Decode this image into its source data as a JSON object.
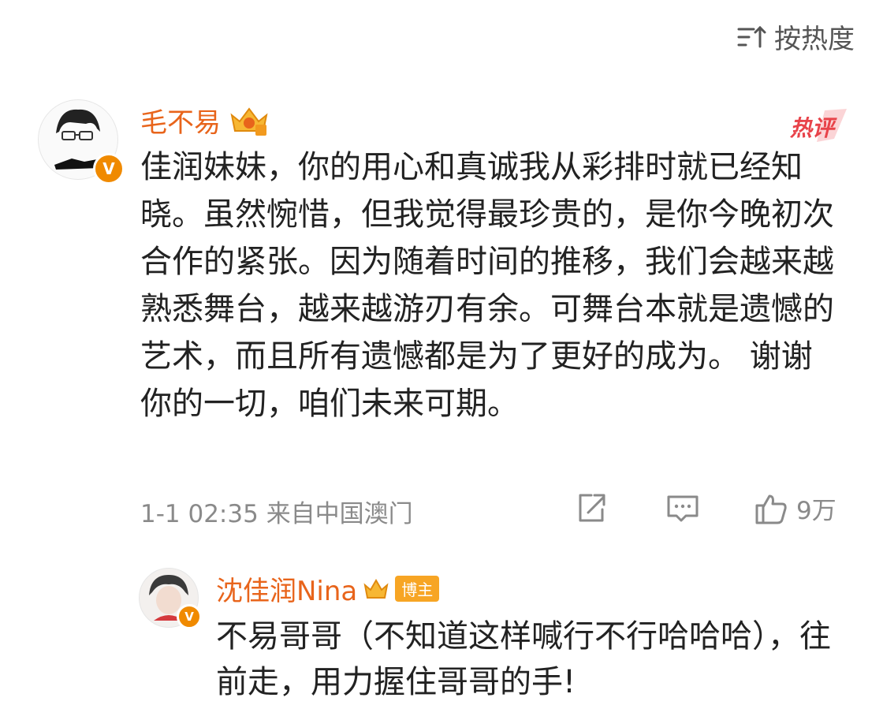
{
  "sort": {
    "label": "按热度",
    "icon": "sort-icon"
  },
  "comment": {
    "username": "毛不易",
    "badge_icon": "crown-badge-icon",
    "hot_label": "热评",
    "text": "佳润妹妹，你的用心和真诚我从彩排时就已经知晓。虽然惋惜，但我觉得最珍贵的，是你今晚初次合作的紧张。因为随着时间的推移，我们会越来越熟悉舞台，越来越游刃有余。可舞台本就是遗憾的艺术，而且所有遗憾都是为了更好的成为。 谢谢你的一切，咱们未来可期。",
    "time": "1-1 02:35",
    "location": "来自中国澳门",
    "likes": "9万"
  },
  "reply": {
    "username": "沈佳润Nina",
    "tag": "博主",
    "text": "不易哥哥（不知道这样喊行不行哈哈哈），往前走，用力握住哥哥的手!"
  },
  "colors": {
    "username": "#e8641b",
    "hot": "#e8434a",
    "badge": "#f08a00",
    "meta": "#8a8a8a"
  }
}
